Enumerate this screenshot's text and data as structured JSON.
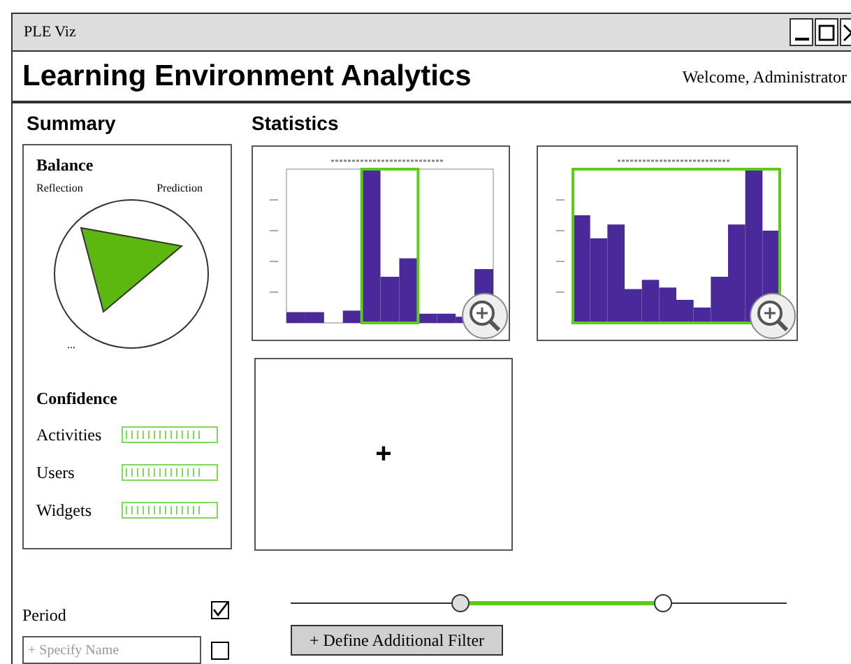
{
  "window": {
    "title": "PLE Viz"
  },
  "header": {
    "title": "Learning Environment Analytics",
    "welcome": "Welcome, Administrator"
  },
  "summary": {
    "heading": "Summary",
    "balance": {
      "title": "Balance",
      "labels": [
        "Reflection",
        "Prediction",
        "..."
      ]
    },
    "confidence": {
      "title": "Confidence",
      "items": [
        {
          "label": "Activities",
          "level": 0.84
        },
        {
          "label": "Users",
          "level": 0.84
        },
        {
          "label": "Widgets",
          "level": 0.84
        }
      ]
    }
  },
  "statistics": {
    "heading": "Statistics",
    "add_label": "+"
  },
  "filters": {
    "period_label": "Period",
    "period_checked": true,
    "name_placeholder": "+ Specify Name",
    "name_checked": false,
    "slider": {
      "thumbs": [
        {
          "level": 0.34
        },
        {
          "level": 0.75
        }
      ]
    },
    "define_button": "+ Define Additional Filter"
  }
}
